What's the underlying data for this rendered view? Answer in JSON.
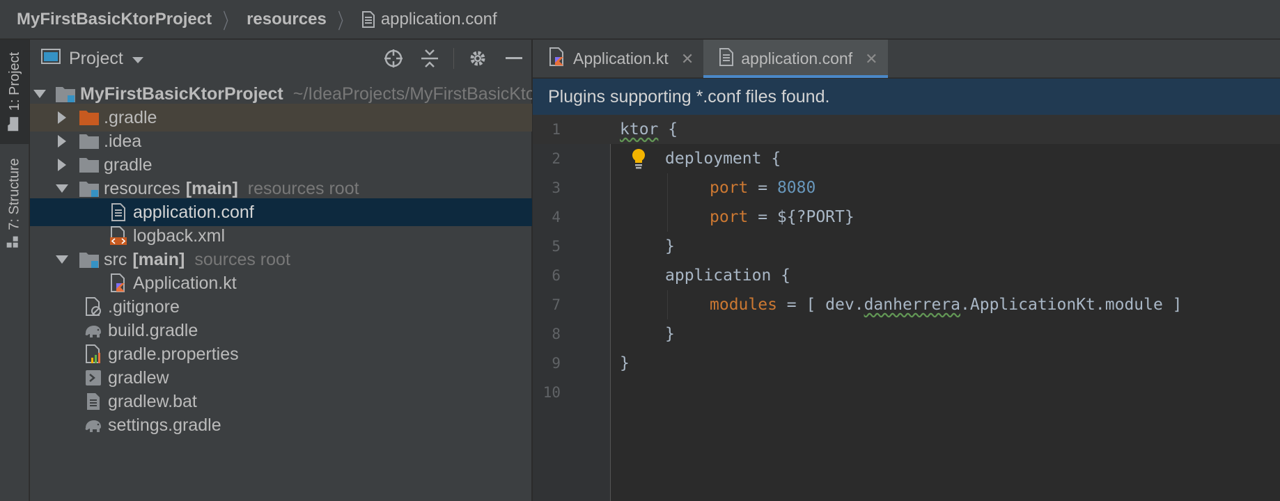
{
  "breadcrumb": {
    "project": "MyFirstBasicKtorProject",
    "folder": "resources",
    "file": "application.conf",
    "separator": "〉"
  },
  "toolstrip": {
    "project_tab": "1: Project",
    "structure_tab": "7: Structure"
  },
  "project_panel": {
    "title": "Project",
    "tree": [
      {
        "name": "MyFirstBasicKtorProject",
        "hint": "~/IdeaProjects/MyFirstBasicKtorProject"
      },
      {
        "name": ".gradle"
      },
      {
        "name": ".idea"
      },
      {
        "name": "gradle"
      },
      {
        "name": "resources",
        "tag": "[main]",
        "hint": "resources root"
      },
      {
        "name": "application.conf"
      },
      {
        "name": "logback.xml"
      },
      {
        "name": "src",
        "tag": "[main]",
        "hint": "sources root"
      },
      {
        "name": "Application.kt"
      },
      {
        "name": ".gitignore"
      },
      {
        "name": "build.gradle"
      },
      {
        "name": "gradle.properties"
      },
      {
        "name": "gradlew"
      },
      {
        "name": "gradlew.bat"
      },
      {
        "name": "settings.gradle"
      }
    ]
  },
  "editor": {
    "tabs": [
      {
        "label": "Application.kt",
        "close": "✕"
      },
      {
        "label": "application.conf",
        "close": "✕"
      }
    ],
    "banner": "Plugins supporting *.conf files found.",
    "line_numbers": [
      "1",
      "2",
      "3",
      "4",
      "5",
      "6",
      "7",
      "8",
      "9",
      "10"
    ],
    "code": {
      "l1_ktor": "ktor",
      "l1_brace": " {",
      "l2_deployment": "deployment {",
      "l3_port": "port",
      "l3_eq": " = ",
      "l3_val": "8080",
      "l4_port": "port",
      "l4_rest": " = ${?PORT}",
      "l5": "}",
      "l6": "application {",
      "l7_modules": "modules",
      "l7_a": " = [ dev.",
      "l7_pkg": "danherrera",
      "l7_b": ".ApplicationKt.module ]",
      "l8": "}",
      "l9": "}"
    }
  },
  "colors": {
    "accent": "#4a88c7",
    "selection": "#0d293e",
    "keyword": "#cc7832",
    "number": "#6897bb",
    "folder_excluded": "#c75a20"
  }
}
